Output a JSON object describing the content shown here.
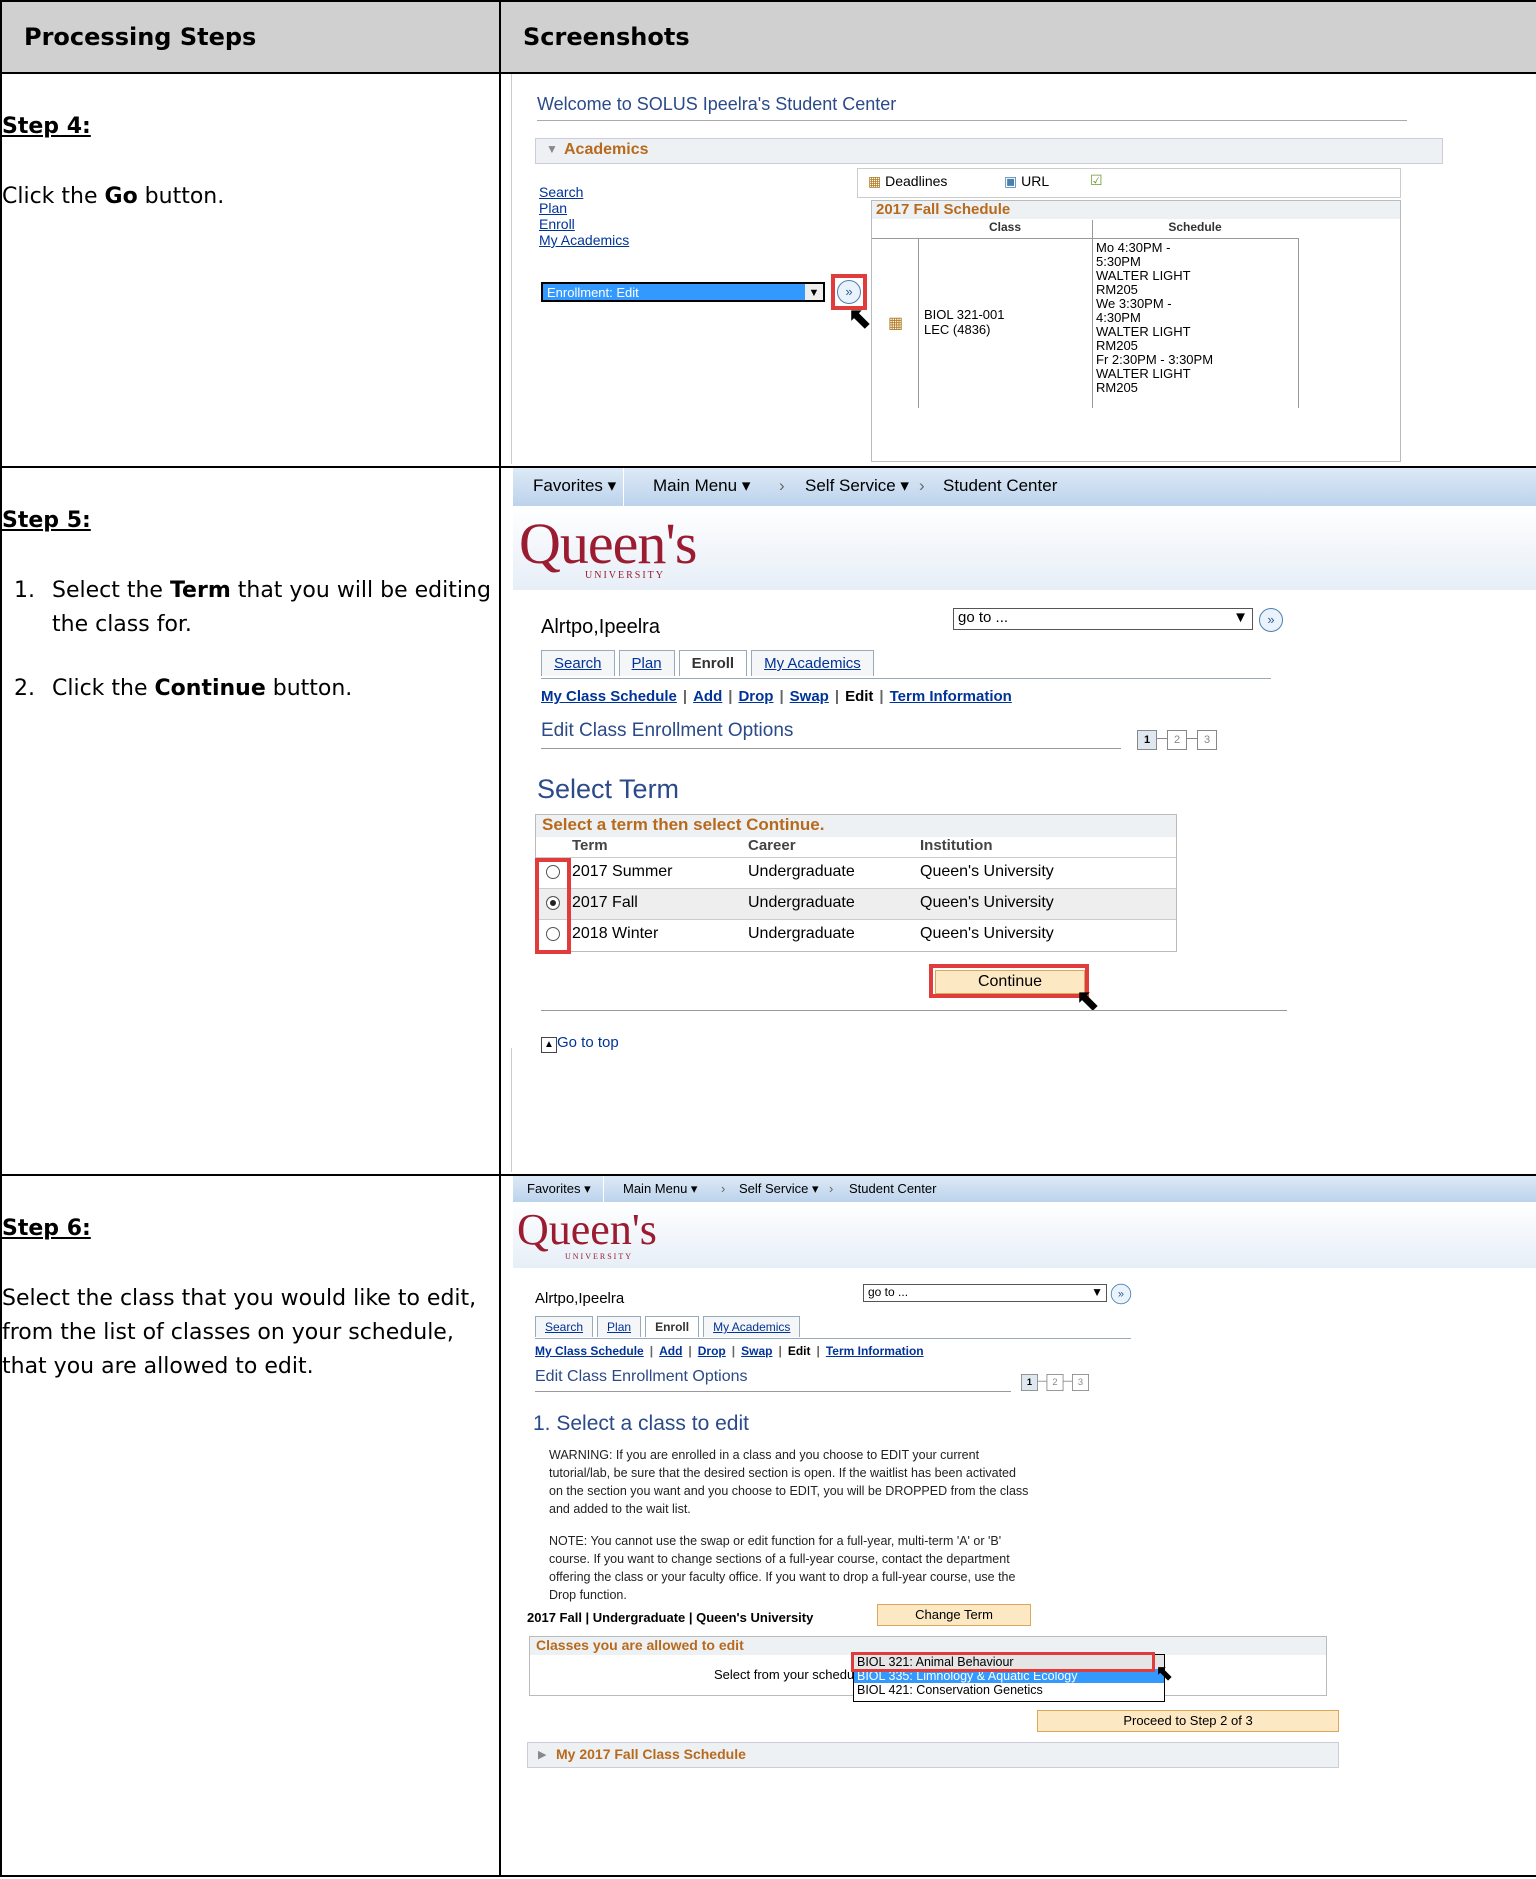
{
  "table": {
    "col1_header": "Processing Steps",
    "col2_header": "Screenshots"
  },
  "step4": {
    "heading": "Step 4:",
    "instruction_pre": "Click the ",
    "instruction_bold": "Go",
    "instruction_post": " button.",
    "shot": {
      "welcome": "Welcome to SOLUS Ipeelra's Student Center",
      "section": "Academics",
      "links": [
        "Search",
        "Plan",
        "Enroll",
        "My Academics"
      ],
      "tools": [
        "Deadlines",
        "URL"
      ],
      "dropdown_value": "Enrollment: Edit",
      "schedule_title": "2017 Fall Schedule",
      "col_class": "Class",
      "col_schedule": "Schedule",
      "class_name": "BIOL 321-001",
      "class_type": "LEC (4836)",
      "schedule_lines": [
        "Mo 4:30PM -",
        "5:30PM",
        "WALTER LIGHT",
        "RM205",
        "We 3:30PM -",
        "4:30PM",
        "WALTER LIGHT",
        "RM205",
        "Fr 2:30PM - 3:30PM",
        "WALTER LIGHT",
        "RM205"
      ]
    }
  },
  "step5": {
    "heading": "Step 5:",
    "item1_pre": "Select the ",
    "item1_bold": "Term",
    "item1_post": " that you will be editing the class for.",
    "item2_pre": "Click the ",
    "item2_bold": "Continue",
    "item2_post": " button.",
    "shot": {
      "nav": [
        "Favorites ▾",
        "Main Menu ▾",
        "›",
        "Self Service ▾",
        "›",
        "Student Center"
      ],
      "logo": "Queen's",
      "logo_sub": "UNIVERSITY",
      "student": "Alrtpo,Ipeelra",
      "goto": "go to ...",
      "tabs": [
        "Search",
        "Plan",
        "Enroll",
        "My Academics"
      ],
      "subnav": [
        "My Class Schedule",
        "Add",
        "Drop",
        "Swap",
        "Edit",
        "Term Information"
      ],
      "page_title": "Edit Class Enrollment Options",
      "steps": [
        "1",
        "2",
        "3"
      ],
      "select_term": "Select Term",
      "grid_title": "Select a term then select Continue.",
      "grid_headers": [
        "Term",
        "Career",
        "Institution"
      ],
      "rows": [
        {
          "term": "2017 Summer",
          "career": "Undergraduate",
          "institution": "Queen's University",
          "selected": false
        },
        {
          "term": "2017 Fall",
          "career": "Undergraduate",
          "institution": "Queen's University",
          "selected": true
        },
        {
          "term": "2018 Winter",
          "career": "Undergraduate",
          "institution": "Queen's University",
          "selected": false
        }
      ],
      "continue": "Continue",
      "go_to_top": "Go to top"
    }
  },
  "step6": {
    "heading": "Step 6:",
    "instruction": "Select the class that you would like to edit, from the list of classes on your schedule, that you are allowed to edit.",
    "shot": {
      "nav": [
        "Favorites ▾",
        "Main Menu ▾",
        "›",
        "Self Service ▾",
        "›",
        "Student Center"
      ],
      "logo": "Queen's",
      "logo_sub": "UNIVERSITY",
      "student": "Alrtpo,Ipeelra",
      "goto": "go to ...",
      "tabs": [
        "Search",
        "Plan",
        "Enroll",
        "My Academics"
      ],
      "subnav": [
        "My Class Schedule",
        "Add",
        "Drop",
        "Swap",
        "Edit",
        "Term Information"
      ],
      "page_title": "Edit Class Enrollment Options",
      "steps": [
        "1",
        "2",
        "3"
      ],
      "section_title": "1.  Select a class to edit",
      "warning": "WARNING: If you are enrolled in a class and you choose to EDIT your current tutorial/lab, be sure that the desired section is open. If the waitlist has been activated on the section you want and you choose to EDIT, you will be DROPPED from the class and added to the wait list.",
      "note": "NOTE: You cannot use the swap or edit function for a full-year, multi-term 'A' or 'B' course. If you want to change sections of a full-year course, contact the department offering the class or your faculty office. If you want to drop a full-year course, use the Drop function.",
      "term_line": "2017 Fall | Undergraduate | Queen's University",
      "change_term": "Change Term",
      "classes_header": "Classes you are allowed to edit",
      "select_label": "Select from your schedule",
      "options": [
        "BIOL 321: Animal Behaviour",
        "BIOL 335: Limnology & Aquatic Ecology",
        "BIOL 421: Conservation Genetics"
      ],
      "proceed": "Proceed to Step 2 of 3",
      "my_schedule": "My 2017 Fall Class Schedule"
    }
  },
  "colors": {
    "nav_bg": "#c6d9ee",
    "orange": "#b86a1c",
    "red_highlight": "#e03c3c",
    "button_bg": "#fde8c4",
    "select_blue": "#3399ff"
  }
}
